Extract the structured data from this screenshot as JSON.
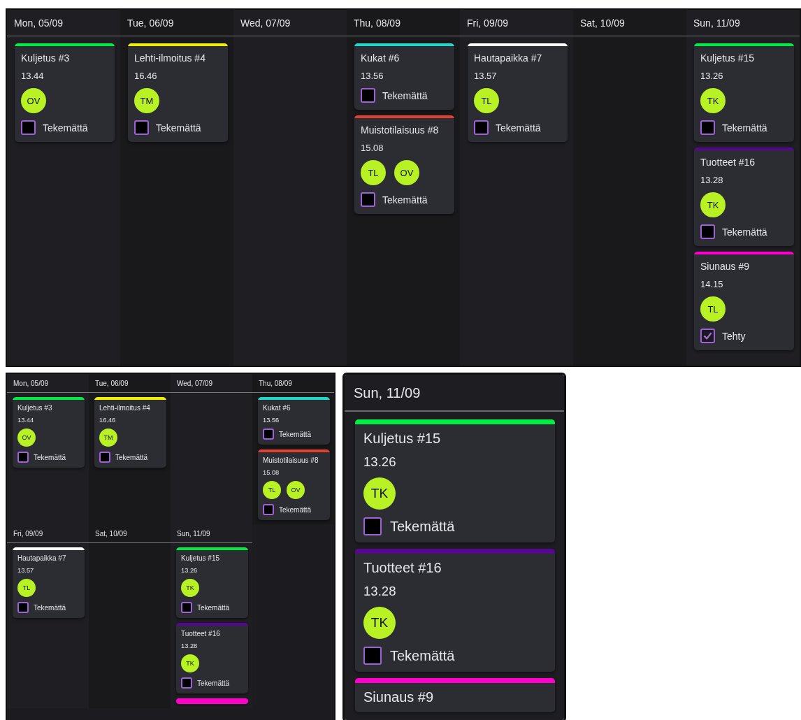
{
  "views": [
    {
      "kind": "week",
      "days": [
        {
          "label": "Mon, 05/09",
          "events": [
            {
              "title": "Kuljetus #3",
              "time": "13.44",
              "color": "#00ee44",
              "assignees": [
                "OV"
              ],
              "checked": false,
              "status": "Tekemättä"
            }
          ]
        },
        {
          "label": "Tue, 06/09",
          "events": [
            {
              "title": "Lehti-ilmoitus #4",
              "time": "16.46",
              "color": "#eeee00",
              "assignees": [
                "TM"
              ],
              "checked": false,
              "status": "Tekemättä"
            }
          ]
        },
        {
          "label": "Wed, 07/09"
        },
        {
          "label": "Thu, 08/09",
          "events": [
            {
              "title": "Kukat #6",
              "time": "13.56",
              "color": "#20d8c8",
              "checked": false,
              "status": "Tekemättä"
            },
            {
              "title": "Muistotilaisuus #8",
              "time": "15.08",
              "color": "#e04030",
              "assignees": [
                "TL",
                "OV"
              ],
              "checked": false,
              "status": "Tekemättä"
            }
          ]
        },
        {
          "label": "Fri, 09/09",
          "events": [
            {
              "title": "Hautapaikka #7",
              "time": "13.57",
              "color": "#ffffff",
              "assignees": [
                "TL"
              ],
              "checked": false,
              "status": "Tekemättä"
            }
          ]
        },
        {
          "label": "Sat, 10/09"
        },
        {
          "label": "Sun, 11/09",
          "events": [
            {
              "title": "Kuljetus #15",
              "time": "13.26",
              "color": "#00ee44",
              "assignees": [
                "TK"
              ],
              "checked": false,
              "status": "Tekemättä"
            },
            {
              "title": "Tuotteet #16",
              "time": "13.28",
              "color": "#55088f",
              "assignees": [
                "TK"
              ],
              "checked": false,
              "status": "Tekemättä"
            },
            {
              "title": "Siunaus #9",
              "time": "14.15",
              "color": "#ff00cc",
              "assignees": [
                "TL"
              ],
              "checked": true,
              "status": "Tehty"
            }
          ]
        }
      ]
    },
    {
      "kind": "grid",
      "days": [
        {
          "label": "Mon, 05/09",
          "events": [
            {
              "title": "Kuljetus #3",
              "time": "13.44",
              "color": "#00ee44",
              "assignees": [
                "OV"
              ],
              "checked": false,
              "status": "Tekemättä"
            }
          ]
        },
        {
          "label": "Tue, 06/09",
          "events": [
            {
              "title": "Lehti-ilmoitus #4",
              "time": "16.46",
              "color": "#eeee00",
              "assignees": [
                "TM"
              ],
              "checked": false,
              "status": "Tekemättä"
            }
          ]
        },
        {
          "label": "Wed, 07/09"
        },
        {
          "label": "Thu, 08/09",
          "events": [
            {
              "title": "Kukat #6",
              "time": "13.56",
              "color": "#20d8c8",
              "checked": false,
              "status": "Tekemättä"
            },
            {
              "title": "Muistotilaisuus #8",
              "time": "15.08",
              "color": "#e04030",
              "assignees": [
                "TL",
                "OV"
              ],
              "checked": false,
              "status": "Tekemättä"
            }
          ]
        },
        {
          "label": "Fri, 09/09",
          "events": [
            {
              "title": "Hautapaikka #7",
              "time": "13.57",
              "color": "#ffffff",
              "assignees": [
                "TL"
              ],
              "checked": false,
              "status": "Tekemättä"
            }
          ]
        },
        {
          "label": "Sat, 10/09"
        },
        {
          "label": "Sun, 11/09",
          "events": [
            {
              "title": "Kuljetus #15",
              "time": "13.26",
              "color": "#00ee44",
              "assignees": [
                "TK"
              ],
              "checked": false,
              "status": "Tekemättä"
            },
            {
              "title": "Tuotteet #16",
              "time": "13.28",
              "color": "#55088f",
              "assignees": [
                "TK"
              ],
              "checked": false,
              "status": "Tekemättä"
            },
            {
              "color": "#ff00cc"
            }
          ]
        }
      ]
    },
    {
      "kind": "day",
      "days": [
        {
          "label": "Sun, 11/09",
          "events": [
            {
              "title": "Kuljetus #15",
              "time": "13.26",
              "color": "#00ee44",
              "assignees": [
                "TK"
              ],
              "checked": false,
              "status": "Tekemättä"
            },
            {
              "title": "Tuotteet #16",
              "time": "13.28",
              "color": "#55088f",
              "assignees": [
                "TK"
              ],
              "checked": false,
              "status": "Tekemättä"
            },
            {
              "title": "Siunaus #9",
              "color": "#ff00cc"
            }
          ]
        }
      ]
    }
  ]
}
